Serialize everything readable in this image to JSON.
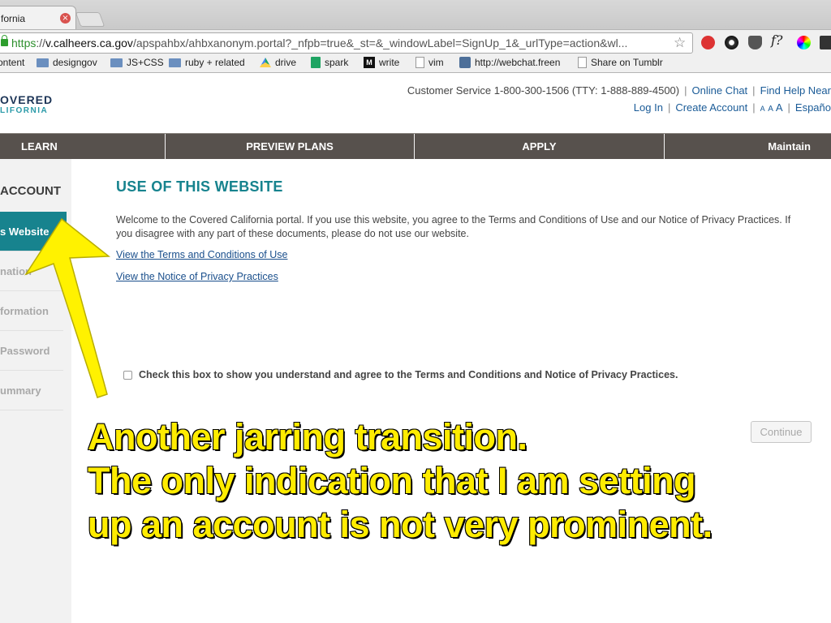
{
  "browser": {
    "tab_title": "fornia",
    "tab_close": "×",
    "url_scheme": "https",
    "url_sep": "://",
    "url_host": "v.calheers.ca.gov",
    "url_path": "/apspahbx/ahbxanonym.portal?_nfpb=true&_st=&_windowLabel=SignUp_1&_urlType=action&wl...",
    "star": "☆",
    "ext_fx": "f?",
    "bookmarks": [
      "ontent",
      "designgov",
      "JS+CSS",
      "ruby + related",
      "drive",
      "spark",
      "write",
      "vim",
      "http://webchat.freen",
      "Share on Tumblr"
    ]
  },
  "site": {
    "logo_line1": "OVERED",
    "logo_line2": "LIFORNIA",
    "customer_service": "Customer Service 1-800-300-1506 (TTY: 1-888-889-4500)",
    "online_chat": "Online Chat",
    "find_help": "Find Help Near",
    "log_in": "Log In",
    "create_account": "Create Account",
    "size_s": "A",
    "size_m": "A",
    "size_l": "A",
    "espanol": "Españo",
    "sep": "|"
  },
  "nav": [
    "LEARN",
    "PREVIEW PLANS",
    "APPLY",
    "Maintain"
  ],
  "sidebar": {
    "title": "ACCOUNT",
    "items": [
      "s Website",
      "nation",
      "formation",
      "Password",
      "ummary"
    ]
  },
  "main": {
    "title": "USE OF THIS WEBSITE",
    "intro": "Welcome to the Covered California portal. If you use this website, you agree to the Terms and Conditions of Use and our Notice of Privacy Practices. If you disagree with any part of these documents, please do not use our website.",
    "link_terms": "View the Terms and Conditions of Use",
    "link_privacy": "View the Notice of Privacy Practices",
    "agree_label": "Check this box to show you understand and agree to the Terms and Conditions and Notice of Privacy Practices.",
    "continue_label": "Continue"
  },
  "annotation": {
    "lines": [
      "Another jarring transition.",
      "The only indication that I am setting",
      "up an account is not very prominent."
    ],
    "color": "#ffec00"
  }
}
